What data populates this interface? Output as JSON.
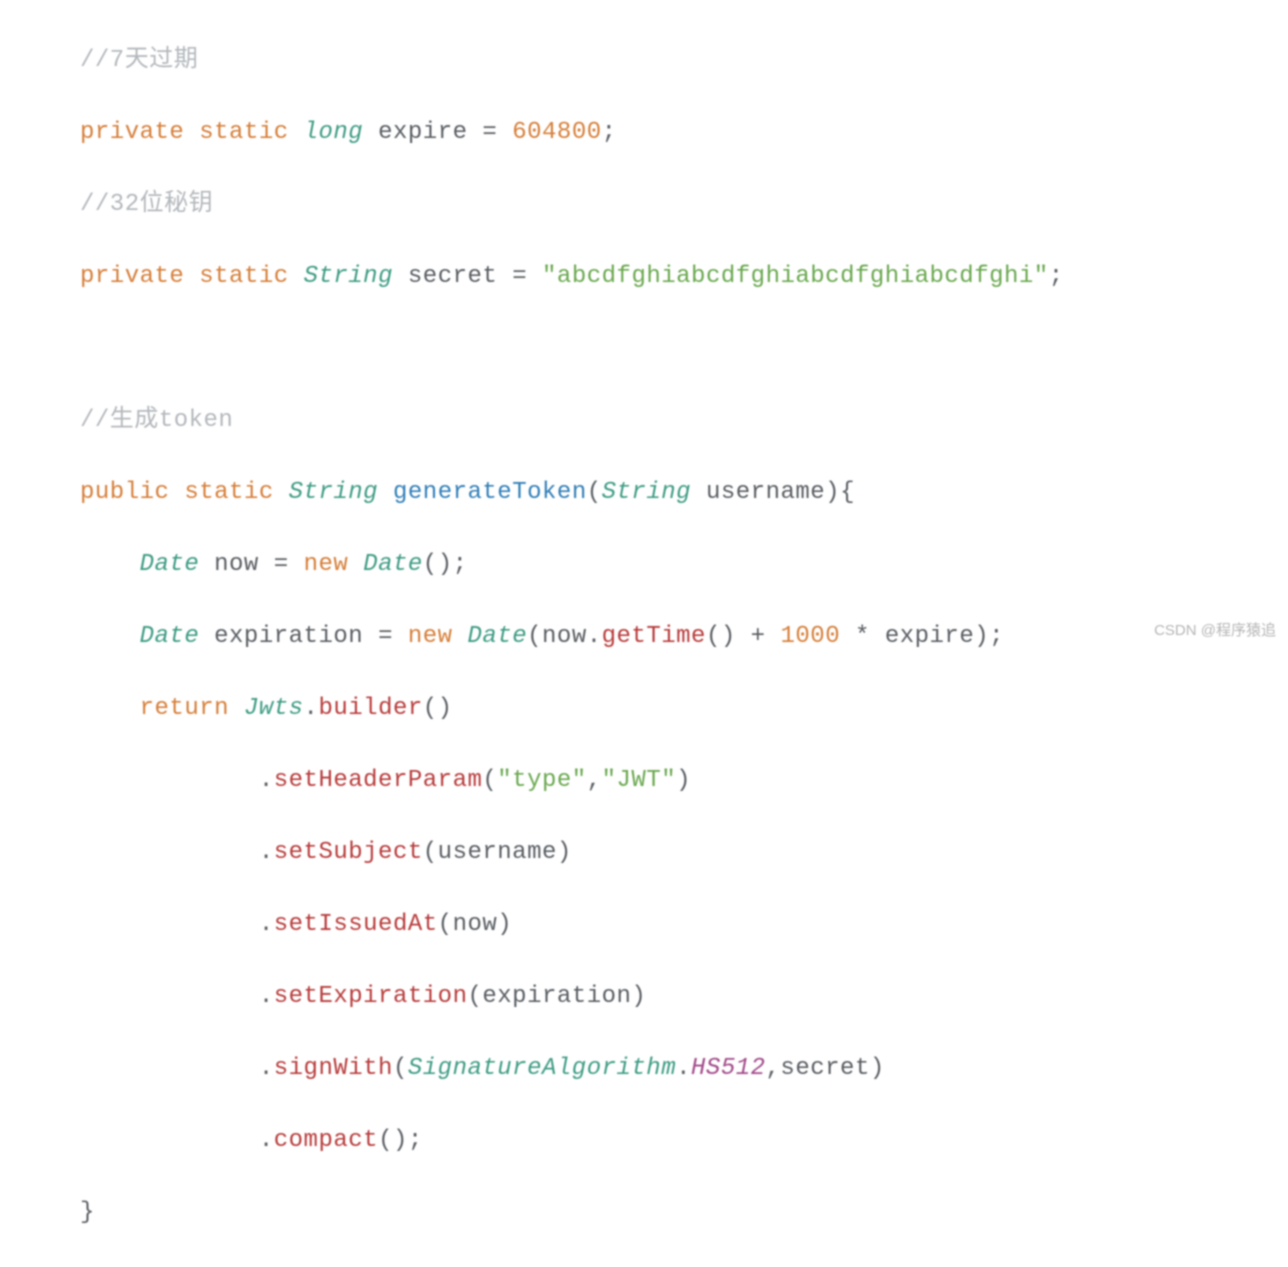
{
  "code": {
    "l1": {
      "t1": "//7天过期"
    },
    "l2": {
      "t1": "private",
      "t2": "static",
      "t3": "long",
      "t4": "expire",
      "t5": "=",
      "t6": "604800",
      "t7": ";"
    },
    "l3": {
      "t1": "//32位秘钥"
    },
    "l4": {
      "t1": "private",
      "t2": "static",
      "t3": "String",
      "t4": "secret",
      "t5": "=",
      "t6": "\"abcdfghiabcdfghiabcdfghiabcdfghi\"",
      "t7": ";"
    },
    "l6": {
      "t1": "//生成token"
    },
    "l7": {
      "t1": "public",
      "t2": "static",
      "t3": "String",
      "t4": "generateToken",
      "t5": "(",
      "t6": "String",
      "t7": "username",
      "t8": "){"
    },
    "l8": {
      "t1": "Date",
      "t2": "now",
      "t3": "=",
      "t4": "new",
      "t5": "Date",
      "t6": "();"
    },
    "l9": {
      "t1": "Date",
      "t2": "expiration",
      "t3": "=",
      "t4": "new",
      "t5": "Date",
      "t6": "(now.",
      "t7": "getTime",
      "t8": "()",
      "t9": "+",
      "t10": "1000",
      "t11": "*",
      "t12": "expire);"
    },
    "l10": {
      "t1": "return",
      "t2": "Jwts",
      "t3": ".",
      "t4": "builder",
      "t5": "()"
    },
    "l11": {
      "t1": ".",
      "t2": "setHeaderParam",
      "t3": "(",
      "t4": "\"type\"",
      "t5": ",",
      "t6": "\"JWT\"",
      "t7": ")"
    },
    "l12": {
      "t1": ".",
      "t2": "setSubject",
      "t3": "(username)"
    },
    "l13": {
      "t1": ".",
      "t2": "setIssuedAt",
      "t3": "(now)"
    },
    "l14": {
      "t1": ".",
      "t2": "setExpiration",
      "t3": "(expiration)"
    },
    "l15": {
      "t1": ".",
      "t2": "signWith",
      "t3": "(",
      "t4": "SignatureAlgorithm",
      "t5": ".",
      "t6": "HS512",
      "t7": ",secret)"
    },
    "l16": {
      "t1": ".",
      "t2": "compact",
      "t3": "();"
    },
    "l17": {
      "t1": "}"
    }
  },
  "watermark": "CSDN @程序猿追"
}
